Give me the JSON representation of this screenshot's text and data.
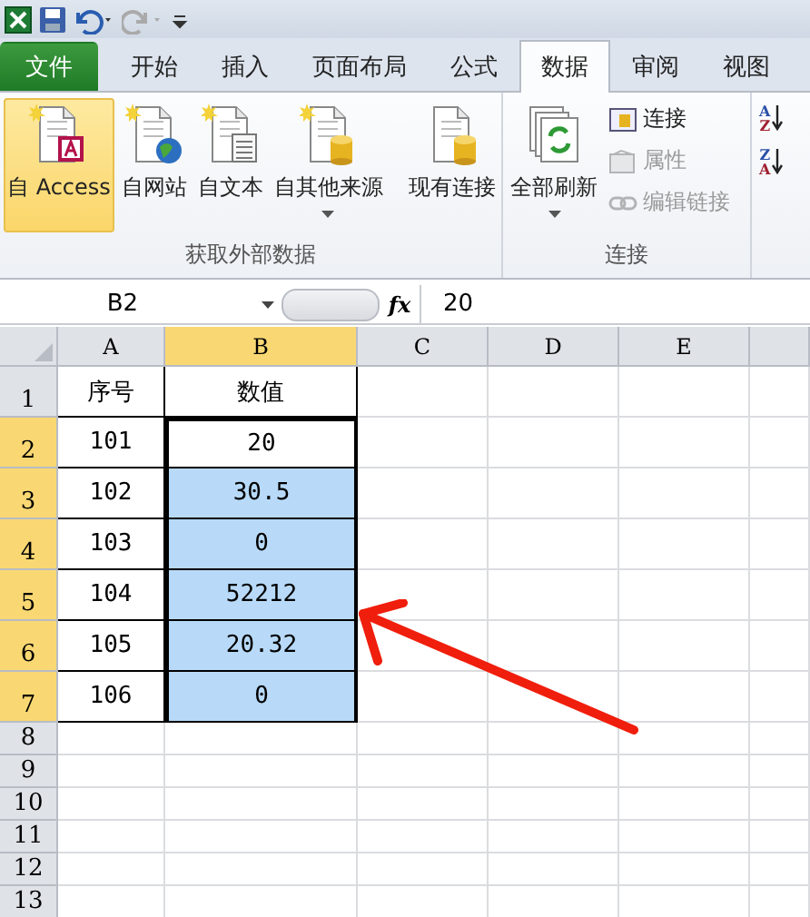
{
  "tabs": [
    {
      "label": "文件",
      "kind": "file",
      "selected": false
    },
    {
      "label": "开始",
      "kind": "tab",
      "selected": false
    },
    {
      "label": "插入",
      "kind": "tab",
      "selected": false
    },
    {
      "label": "页面布局",
      "kind": "tab",
      "selected": false
    },
    {
      "label": "公式",
      "kind": "tab",
      "selected": false
    },
    {
      "label": "数据",
      "kind": "tab",
      "selected": true
    },
    {
      "label": "审阅",
      "kind": "tab",
      "selected": false
    },
    {
      "label": "视图",
      "kind": "tab",
      "selected": false
    }
  ],
  "ribbon": {
    "groups": [
      {
        "label": "获取外部数据",
        "large_buttons": [
          {
            "label": "自 Access",
            "highlighted": true,
            "dropdown": false
          },
          {
            "label": "自网站",
            "highlighted": false,
            "dropdown": false
          },
          {
            "label": "自文本",
            "highlighted": false,
            "dropdown": false
          },
          {
            "label": "自其他来源",
            "highlighted": false,
            "dropdown": true
          },
          {
            "label": "现有连接",
            "highlighted": false,
            "dropdown": false
          }
        ]
      },
      {
        "label": "连接",
        "large_buttons": [
          {
            "label": "全部刷新",
            "highlighted": false,
            "dropdown": true
          }
        ],
        "small_buttons": [
          {
            "label": "连接",
            "disabled": false
          },
          {
            "label": "属性",
            "disabled": true
          },
          {
            "label": "编辑链接",
            "disabled": true
          }
        ]
      }
    ],
    "sort_buttons": [
      {
        "top": "A",
        "bottom": "Z"
      },
      {
        "top": "Z",
        "bottom": "A"
      }
    ]
  },
  "formula_bar": {
    "name_box": "B2",
    "function_label": "fx",
    "value": "20"
  },
  "sheet": {
    "columns": [
      {
        "label": "A",
        "selected": false
      },
      {
        "label": "B",
        "selected": true
      },
      {
        "label": "C",
        "selected": false
      },
      {
        "label": "D",
        "selected": false
      },
      {
        "label": "E",
        "selected": false
      }
    ],
    "rows": [
      {
        "number": "1",
        "selected": false,
        "cells": [
          {
            "text": "序号"
          },
          {
            "text": "数值",
            "selected": false,
            "active": false
          }
        ]
      },
      {
        "number": "2",
        "selected": true,
        "cells": [
          {
            "text": "101"
          },
          {
            "text": "20",
            "selected": false,
            "active": true
          }
        ]
      },
      {
        "number": "3",
        "selected": true,
        "cells": [
          {
            "text": "102"
          },
          {
            "text": "30.5",
            "selected": true,
            "active": false
          }
        ]
      },
      {
        "number": "4",
        "selected": true,
        "cells": [
          {
            "text": "103"
          },
          {
            "text": "0",
            "selected": true,
            "active": false
          }
        ]
      },
      {
        "number": "5",
        "selected": true,
        "cells": [
          {
            "text": "104"
          },
          {
            "text": "52212",
            "selected": true,
            "active": false
          }
        ]
      },
      {
        "number": "6",
        "selected": true,
        "cells": [
          {
            "text": "105"
          },
          {
            "text": "20.32",
            "selected": true,
            "active": false
          }
        ]
      },
      {
        "number": "7",
        "selected": true,
        "cells": [
          {
            "text": "106"
          },
          {
            "text": "0",
            "selected": true,
            "active": false
          }
        ]
      },
      {
        "number": "8",
        "selected": false,
        "cells": []
      },
      {
        "number": "9",
        "selected": false,
        "cells": []
      },
      {
        "number": "10",
        "selected": false,
        "cells": []
      },
      {
        "number": "11",
        "selected": false,
        "cells": []
      },
      {
        "number": "12",
        "selected": false,
        "cells": []
      },
      {
        "number": "13",
        "selected": false,
        "cells": []
      }
    ]
  }
}
